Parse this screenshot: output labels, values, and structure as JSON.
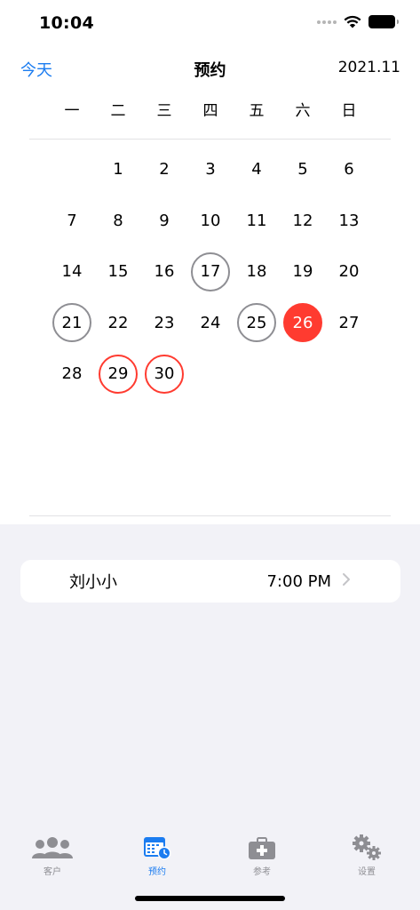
{
  "status_bar": {
    "time": "10:04"
  },
  "nav": {
    "today_label": "今天",
    "title": "预约",
    "month": "2021.11"
  },
  "weekdays": [
    "一",
    "二",
    "三",
    "四",
    "五",
    "六",
    "日"
  ],
  "calendar": {
    "leading_blanks": 1,
    "days": [
      {
        "n": "1",
        "mark": ""
      },
      {
        "n": "2",
        "mark": ""
      },
      {
        "n": "3",
        "mark": ""
      },
      {
        "n": "4",
        "mark": ""
      },
      {
        "n": "5",
        "mark": ""
      },
      {
        "n": "6",
        "mark": ""
      },
      {
        "n": "7",
        "mark": ""
      },
      {
        "n": "8",
        "mark": ""
      },
      {
        "n": "9",
        "mark": ""
      },
      {
        "n": "10",
        "mark": ""
      },
      {
        "n": "11",
        "mark": ""
      },
      {
        "n": "12",
        "mark": ""
      },
      {
        "n": "13",
        "mark": ""
      },
      {
        "n": "14",
        "mark": ""
      },
      {
        "n": "15",
        "mark": ""
      },
      {
        "n": "16",
        "mark": ""
      },
      {
        "n": "17",
        "mark": "gray"
      },
      {
        "n": "18",
        "mark": ""
      },
      {
        "n": "19",
        "mark": ""
      },
      {
        "n": "20",
        "mark": ""
      },
      {
        "n": "21",
        "mark": "gray"
      },
      {
        "n": "22",
        "mark": ""
      },
      {
        "n": "23",
        "mark": ""
      },
      {
        "n": "24",
        "mark": ""
      },
      {
        "n": "25",
        "mark": "gray"
      },
      {
        "n": "26",
        "mark": "filled"
      },
      {
        "n": "27",
        "mark": ""
      },
      {
        "n": "28",
        "mark": ""
      },
      {
        "n": "29",
        "mark": "red"
      },
      {
        "n": "30",
        "mark": "red"
      }
    ]
  },
  "appointment": {
    "name": "刘小小",
    "time": "7:00 PM",
    "chevron_icon": "chevron-right-icon"
  },
  "tab_bar": {
    "tabs": [
      {
        "label": "客户",
        "icon": "people-icon",
        "active": false
      },
      {
        "label": "预约",
        "icon": "calendar-clock-icon",
        "active": true
      },
      {
        "label": "参考",
        "icon": "medical-kit-icon",
        "active": false
      },
      {
        "label": "设置",
        "icon": "gears-icon",
        "active": false
      }
    ]
  },
  "colors": {
    "accent": "#1b7cf0",
    "today": "#ff3b30",
    "marked": "#8e8e93",
    "background_lower": "#f2f2f7"
  }
}
